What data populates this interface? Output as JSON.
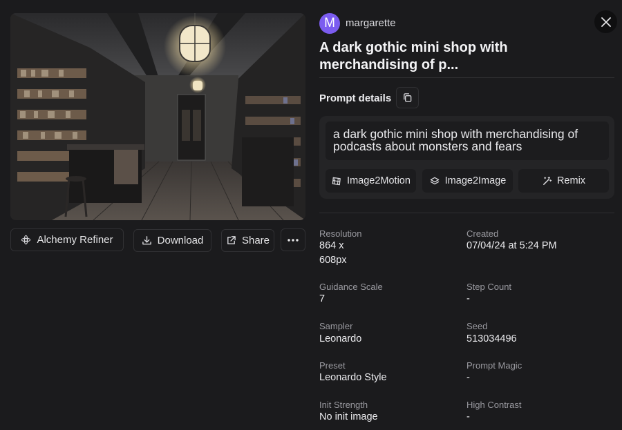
{
  "user": {
    "initial": "M",
    "name": "margarette"
  },
  "title": "A dark gothic mini shop with merchandising of p...",
  "prompt_details": {
    "label": "Prompt details",
    "prompt": "a dark gothic mini shop with merchandising of podcasts about monsters and fears",
    "buttons": {
      "image2motion": "Image2Motion",
      "image2image": "Image2Image",
      "remix": "Remix"
    }
  },
  "actions": {
    "alchemy_refiner": "Alchemy Refiner",
    "download": "Download",
    "share": "Share"
  },
  "meta": {
    "resolution": {
      "label": "Resolution",
      "value_line1": "864 x",
      "value_line2": "608px"
    },
    "created": {
      "label": "Created",
      "value": "07/04/24 at 5:24 PM"
    },
    "guidance_scale": {
      "label": "Guidance Scale",
      "value": "7"
    },
    "step_count": {
      "label": "Step Count",
      "value": "-"
    },
    "sampler": {
      "label": "Sampler",
      "value": "Leonardo"
    },
    "seed": {
      "label": "Seed",
      "value": "513034496"
    },
    "preset": {
      "label": "Preset",
      "value": "Leonardo Style"
    },
    "prompt_magic": {
      "label": "Prompt Magic",
      "value": "-"
    },
    "init_strength": {
      "label": "Init Strength",
      "value": "No init image"
    },
    "high_contrast": {
      "label": "High Contrast",
      "value": "-"
    }
  },
  "colors": {
    "background": "#1b1b1d",
    "avatar": "#7b5cf0",
    "card": "#242426"
  }
}
